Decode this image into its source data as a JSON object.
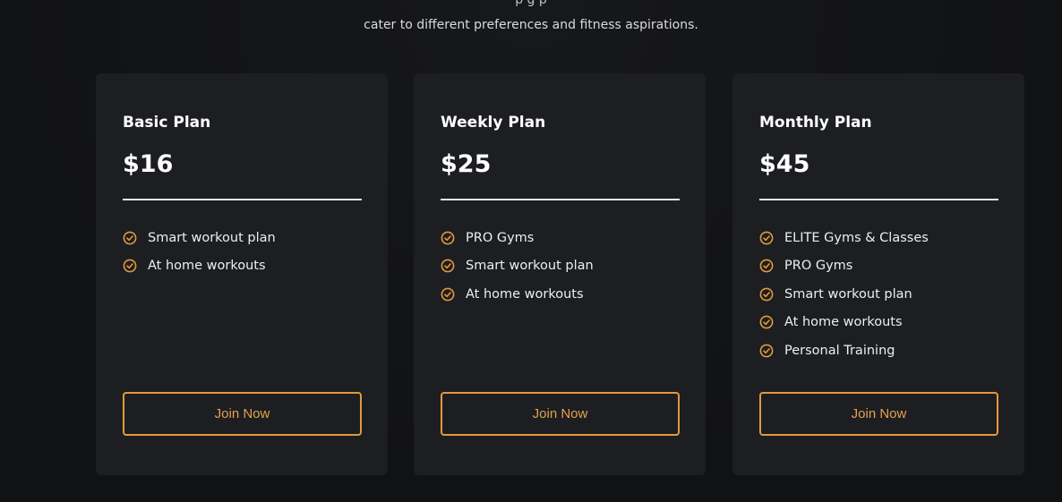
{
  "intro": {
    "line1": "p    g                                                 p   ",
    "line2": "cater to different preferences and fitness aspirations."
  },
  "colors": {
    "background": "#131416",
    "card": "#1d1e22",
    "accent": "#e29a3a",
    "text": "#ffffff"
  },
  "plans": [
    {
      "title": "Basic Plan",
      "price": "$16",
      "features": [
        "Smart workout plan",
        "At home workouts"
      ],
      "button": "Join Now"
    },
    {
      "title": "Weekly Plan",
      "price": "$25",
      "features": [
        "PRO Gyms",
        "Smart workout plan",
        "At home workouts"
      ],
      "button": "Join Now"
    },
    {
      "title": "Monthly Plan",
      "price": "$45",
      "features": [
        "ELITE Gyms & Classes",
        "PRO Gyms",
        "Smart workout plan",
        "At home workouts",
        "Personal Training"
      ],
      "button": "Join Now"
    }
  ],
  "icons": {
    "feature": "check-circle-icon"
  }
}
